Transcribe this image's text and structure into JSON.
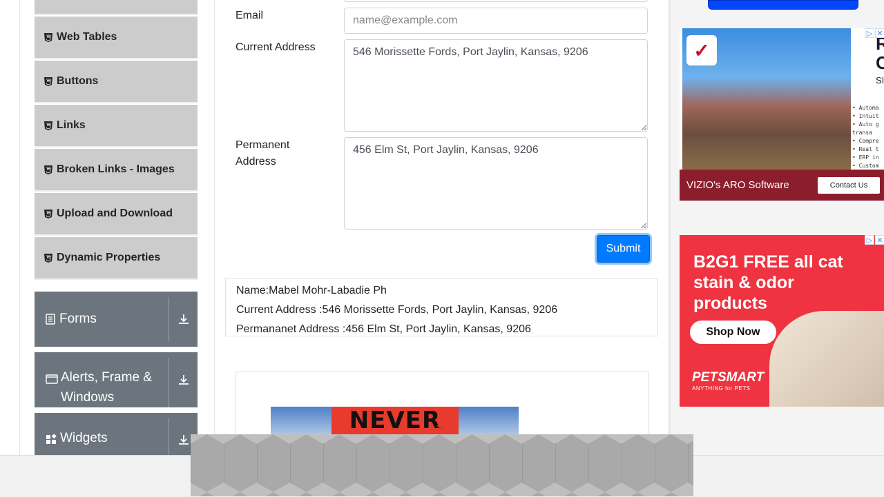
{
  "sidebar": {
    "elements_items": [
      {
        "label": "Web Tables"
      },
      {
        "label": "Buttons"
      },
      {
        "label": "Links"
      },
      {
        "label": "Broken Links - Images"
      },
      {
        "label": "Upload and Download"
      },
      {
        "label": "Dynamic Properties"
      }
    ],
    "groups": [
      {
        "label": "Forms"
      },
      {
        "label": "Alerts, Frame & Windows"
      },
      {
        "label": "Widgets"
      }
    ]
  },
  "form": {
    "email_label": "Email",
    "email_placeholder": "name@example.com",
    "current_address_label": "Current Address",
    "current_address_value": "546 Morissette Fords, Port Jaylin, Kansas, 9206",
    "permanent_address_label": "Permanent Address",
    "permanent_address_value": "456 Elm St, Port Jaylin, Kansas, 9206",
    "submit_label": "Submit"
  },
  "output": {
    "name_line": "Name:Mabel Mohr-Labadie Ph",
    "current_line": "Current Address :546 Morissette Fords, Port Jaylin, Kansas, 9206",
    "permanent_line": "Permananet Address :456 Elm St, Port Jaylin, Kansas, 9206"
  },
  "ads": {
    "ad1_bar_text": "VIZIO's ARO Software",
    "ad1_button": "Contact Us",
    "ad1_partial_big": "R\nC",
    "ad1_partial_small": "SI",
    "ad1_bullets": [
      "• Automa",
      "• Intuit",
      "• Auto g",
      "  transa",
      "• Compre",
      "• Real t",
      "• ERP in",
      "• Custom"
    ],
    "ad2_headline": "B2G1 FREE all cat stain & odor products",
    "ad2_button": "Shop Now",
    "ad2_brand": "PETSMART",
    "ad2_tagline": "ANYTHING for PETS",
    "never_text": "NEVER"
  },
  "colors": {
    "primary": "#007bff",
    "sidebar_item": "#cccccc",
    "group_bg": "#6c757d",
    "ad2_red": "#ef3340"
  }
}
